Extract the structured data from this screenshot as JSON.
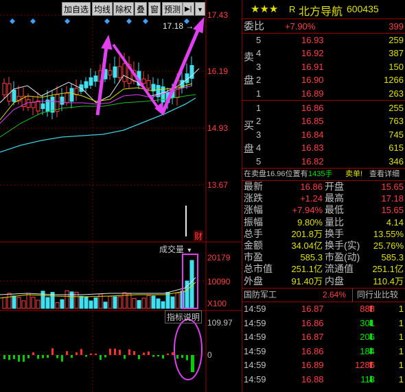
{
  "toolbar": {
    "buttons": [
      "加自选",
      "均线",
      "除权",
      "叠",
      "窗",
      "预测"
    ],
    "expand_label": "▶|",
    "menu_label": "▼"
  },
  "main_chart": {
    "price_axis": [
      "17.43",
      "16.19",
      "14.93",
      "13.67"
    ],
    "high_marker": "17.18",
    "fin_badge": "财"
  },
  "volume_pane": {
    "title": "成交量",
    "axis": [
      "20179",
      "10090"
    ],
    "unit": "X100"
  },
  "indicator_pane": {
    "title": "指标说明",
    "axis": [
      "109.97",
      "0"
    ]
  },
  "stock": {
    "stars": "★★★",
    "flag": "R",
    "name": "北方导航",
    "code": "600435"
  },
  "order_book": {
    "weibi_label": "委比",
    "weibi_pct": "+7.90%",
    "weibi_val": "399",
    "sell_label": [
      "卖",
      "盘"
    ],
    "buy_label": [
      "买",
      "盘"
    ],
    "sell": [
      {
        "lvl": "5",
        "price": "16.93",
        "vol": "259"
      },
      {
        "lvl": "4",
        "price": "16.92",
        "vol": "387"
      },
      {
        "lvl": "3",
        "price": "16.91",
        "vol": "150"
      },
      {
        "lvl": "2",
        "price": "16.90",
        "vol": "1266"
      },
      {
        "lvl": "1",
        "price": "16.89",
        "vol": "263"
      }
    ],
    "buy": [
      {
        "lvl": "1",
        "price": "16.86",
        "vol": "255"
      },
      {
        "lvl": "2",
        "price": "16.85",
        "vol": "763"
      },
      {
        "lvl": "3",
        "price": "16.84",
        "vol": "745"
      },
      {
        "lvl": "4",
        "price": "16.83",
        "vol": "615"
      },
      {
        "lvl": "5",
        "price": "16.82",
        "vol": "346"
      }
    ]
  },
  "hint": {
    "text": "在卖盘16.96位置有",
    "qty": "1435手",
    "action": "卖单!",
    "link": "查看详细"
  },
  "quote": [
    {
      "k1": "最新",
      "v1": "16.86",
      "k2": "开盘",
      "v2": "15.65"
    },
    {
      "k1": "涨跌",
      "v1": "+1.24",
      "k2": "最高",
      "v2": "17.18"
    },
    {
      "k1": "涨幅",
      "v1": "+7.94%",
      "k2": "最低",
      "v2": "15.65"
    },
    {
      "k1": "振幅",
      "v1": "9.80%",
      "k2": "量比",
      "v2": "4.14"
    },
    {
      "k1": "总手",
      "v1": "201.8万",
      "k2": "换手",
      "v2": "13.55%"
    },
    {
      "k1": "金额",
      "v1": "34.04亿",
      "k2": "换手(实)",
      "v2": "25.76%"
    },
    {
      "k1": "市盈",
      "v1": "585.3",
      "k2": "市盈(动)",
      "v2": "585.3"
    },
    {
      "k1": "总市值",
      "v1": "251.1亿",
      "k2": "流通值",
      "v2": "251.1亿"
    },
    {
      "k1": "外盘",
      "v1": "91.40万",
      "k2": "内盘",
      "v2": "110.4万"
    }
  ],
  "sector": {
    "name": "国防军工",
    "pct": "2.64%",
    "compare_label": "同行业比较"
  },
  "ticks": [
    {
      "time": "14:59",
      "price": "16.87",
      "vol": "888",
      "dir": "up",
      "n": "1"
    },
    {
      "time": "14:59",
      "price": "16.86",
      "vol": "301",
      "dir": "down",
      "n": "1"
    },
    {
      "time": "14:59",
      "price": "16.87",
      "vol": "206",
      "dir": "down",
      "n": "1"
    },
    {
      "time": "14:59",
      "price": "16.86",
      "vol": "184",
      "dir": "down",
      "n": "1"
    },
    {
      "time": "14:59",
      "price": "16.89",
      "vol": "1286",
      "dir": "up",
      "n": "1"
    },
    {
      "time": "14:59",
      "price": "16.88",
      "vol": "113",
      "dir": "down",
      "n": "1"
    }
  ],
  "colors": {
    "up": "#ff4040",
    "down": "#00e600",
    "annotation": "#e040f0",
    "ma_cyan": "#40d0e0"
  }
}
